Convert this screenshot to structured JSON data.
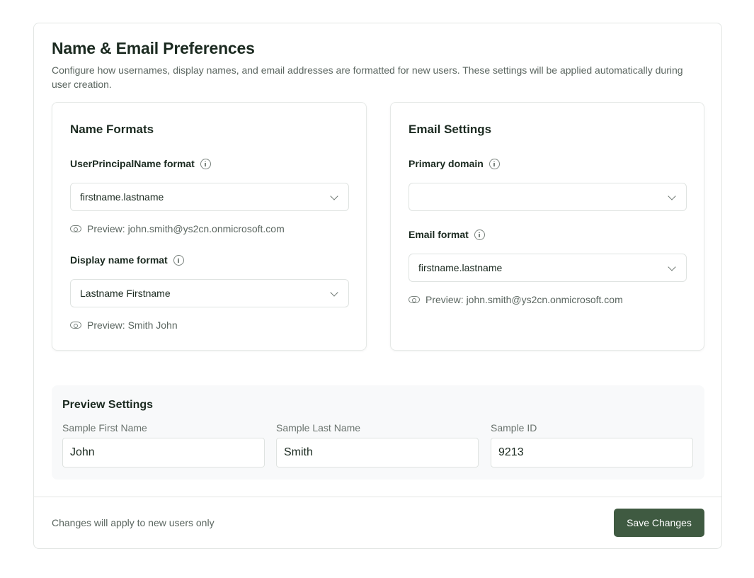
{
  "header": {
    "title": "Name & Email Preferences",
    "description": "Configure how usernames, display names, and email addresses are formatted for new users. These settings will be applied automatically during user creation."
  },
  "name_formats": {
    "title": "Name Formats",
    "upn": {
      "label": "UserPrincipalName format",
      "value": "firstname.lastname",
      "preview": "Preview: john.smith@ys2cn.onmicrosoft.com"
    },
    "display_name": {
      "label": "Display name format",
      "value": "Lastname Firstname",
      "preview": "Preview: Smith John"
    }
  },
  "email_settings": {
    "title": "Email Settings",
    "primary_domain": {
      "label": "Primary domain",
      "value": ""
    },
    "email_format": {
      "label": "Email format",
      "value": "firstname.lastname",
      "preview": "Preview: john.smith@ys2cn.onmicrosoft.com"
    }
  },
  "preview_settings": {
    "title": "Preview Settings",
    "first_name": {
      "label": "Sample First Name",
      "value": "John"
    },
    "last_name": {
      "label": "Sample Last Name",
      "value": "Smith"
    },
    "sample_id": {
      "label": "Sample ID",
      "value": "9213"
    }
  },
  "footer": {
    "note": "Changes will apply to new users only",
    "save_label": "Save Changes"
  },
  "colors": {
    "accent": "#3f5a41",
    "panel_bg": "#f8f9fa"
  }
}
